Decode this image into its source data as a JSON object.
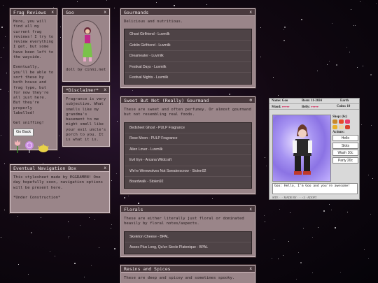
{
  "frag_reviews": {
    "title": "Frag Reviews",
    "close": "x",
    "intro": "Here, you will find all my current frag reviews! I try to review everything I get, but some have been left to the wayside.",
    "body": "Eventually, you'll be able to sort these by both house and frag type, but for now they're all just here. But they're properly labelled!",
    "signoff": "Get sniffing!",
    "back_button": "Go Back"
  },
  "goo_box": {
    "title": "Goo",
    "close": "x",
    "caption": "doll by cinni.net"
  },
  "disclaimer": {
    "title": "*Disclaimer*",
    "close": "x",
    "text": "Fragrance is very subjective. What smells like my grandma's basement to me might smell like your evil uncle's porch to you. It is what it is."
  },
  "nav_box": {
    "title": "Eventual Navigation Box",
    "close": "x",
    "text": "This stylesheet made by EGGRAMEN! One day hopefully soon, navigation options will be present here.",
    "note": "*Under Construction*"
  },
  "gourmands": {
    "title": "Gourmands",
    "close": "x",
    "description": "Delicious and nutritious.",
    "items": [
      "Ghost Girlfriend - Luvmilk",
      "Goblin Girlfriend - Luvmilk",
      "Dreameater - Luvmilk",
      "Festival Days - Luvmilk",
      "Festival Nights - Luvmilk"
    ]
  },
  "sweet_not_gourmand": {
    "title": "Sweet But Not (Really) Gourmand",
    "close": "⚙",
    "description": "These are sweet and often perfumey. Or almost gourmand but not resembling real foods.",
    "items": [
      "Bedsheet Ghost - PULP Fragrance",
      "Rose Moon - PULP Fragrance",
      "Alien Lover - Luvmilk",
      "Evil Eye - Arcana Wildcraft",
      "We're Werewolves Not Sweaterscrow - Stolen92",
      "Boardwalk - Stolen92"
    ]
  },
  "florals": {
    "title": "Florals",
    "close": "x",
    "description": "These are either literally just floral or dominated heavily by floral notes/aspects.",
    "items": [
      "Skeleton Cheese - BPAL",
      "Asses Plus Long, Qu'un Siecle Platonique - BPAL"
    ]
  },
  "resins": {
    "title": "Resins and Spices",
    "close": "x",
    "description": "These are deep and spicey and sometimes spooky."
  },
  "pet_widget": {
    "name_label": "Name:",
    "name_value": "Goo",
    "born_label": "Born:",
    "born_value": "11-2024",
    "planet_value": "Earth",
    "mood_label": "Mood:",
    "mood_value": "♥♥♥♥♥",
    "belly_label": "Belly:",
    "belly_value": "♥♥♥♥♥",
    "coins_label": "Coins:",
    "coins_value": "10",
    "shop_label": "Shop: (6c)",
    "actions_label": "Actions:",
    "actions": [
      "Hello",
      "Slots",
      "Wash 10c",
      "Party 20c"
    ],
    "message": "Goo: Hello, I'm Goo and you're awesome!",
    "footer": "SITE · · · MADE BY · · · <3 · ADOPT"
  }
}
